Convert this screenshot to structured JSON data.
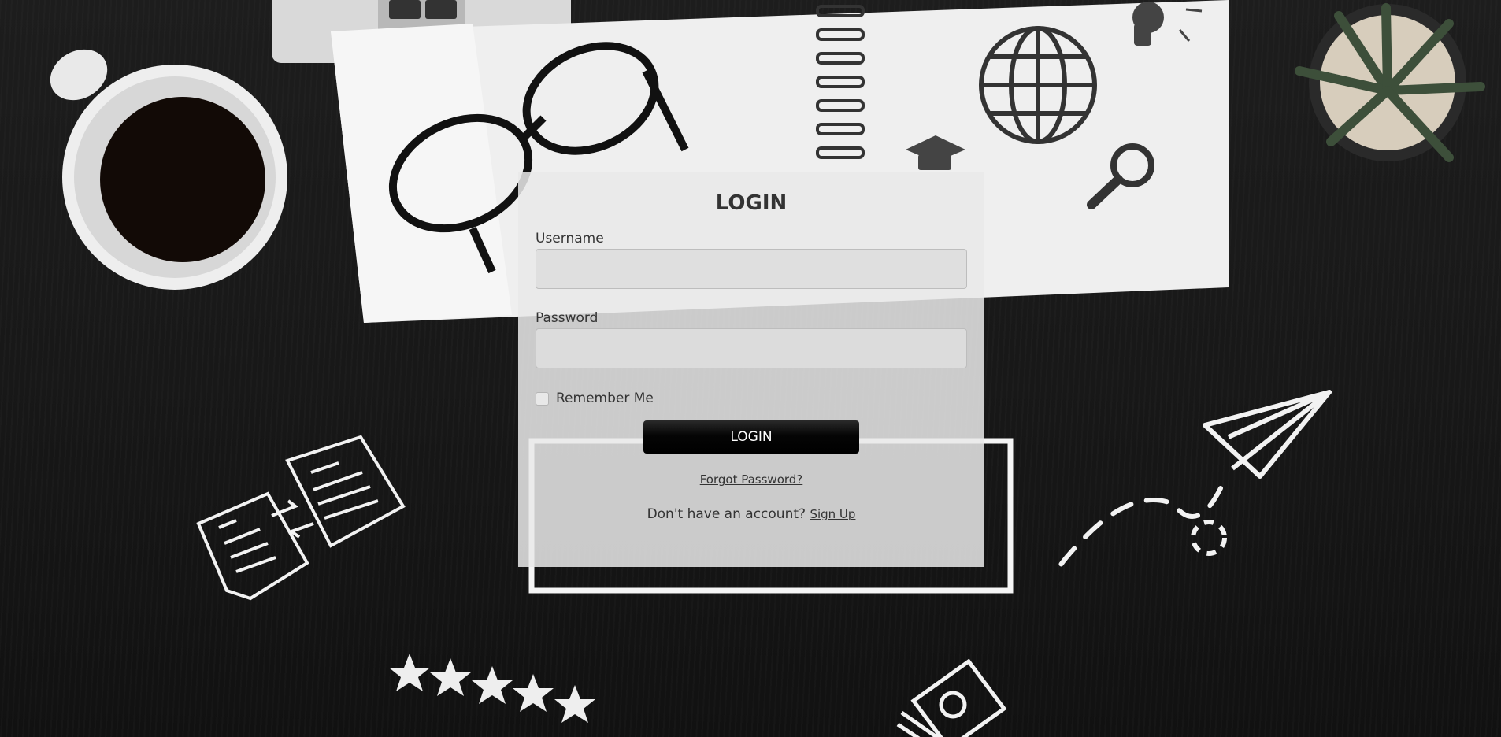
{
  "form": {
    "title": "LOGIN",
    "username_label": "Username",
    "username_value": "",
    "password_label": "Password",
    "password_value": "",
    "remember_label": "Remember Me",
    "remember_checked": false,
    "login_button_label": "LOGIN",
    "forgot_password_link": "Forgot Password?",
    "signup_prompt": "Don't have an account?",
    "signup_link": "Sign Up"
  },
  "background": {
    "icons": [
      "coffee-cup-icon",
      "laptop-icon",
      "eyeglasses-icon",
      "spiral-notebook-icon",
      "globe-icon",
      "graduation-cap-icon",
      "magnifier-icon",
      "lightbulb-icon",
      "succulent-plant-icon",
      "documents-exchange-icon",
      "paper-plane-icon",
      "stars-rating-icon",
      "money-bills-icon"
    ],
    "rating_stars": 5
  },
  "colors": {
    "background": "#181818",
    "card": "#e9e9e9",
    "button": "#000000",
    "text": "#333333"
  }
}
